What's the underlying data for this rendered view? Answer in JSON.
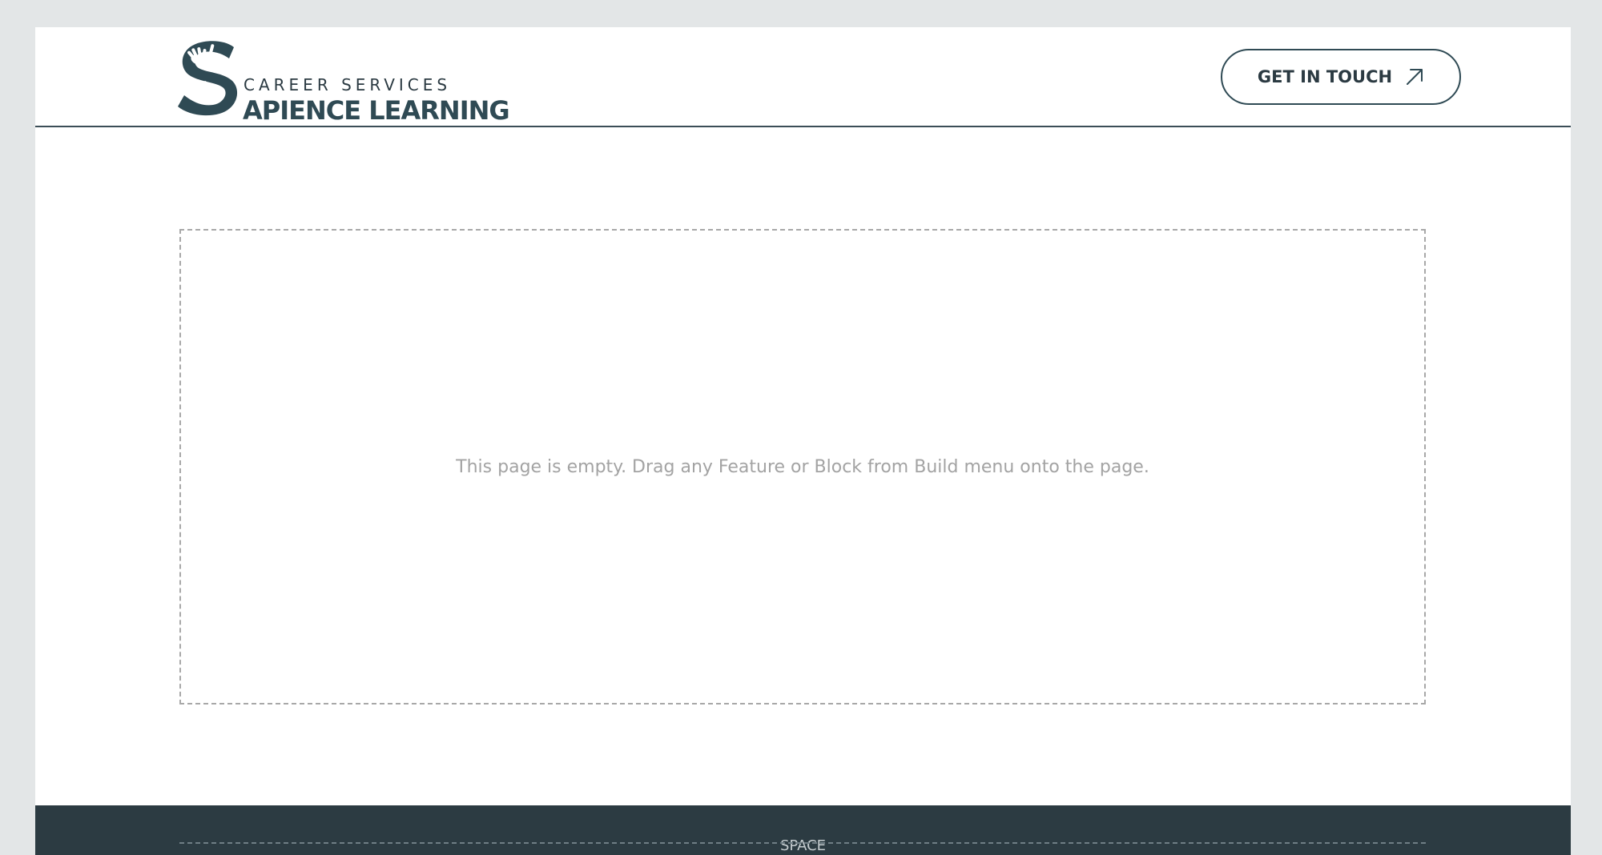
{
  "header": {
    "logo": {
      "subtitle": "CAREER SERVICES",
      "title": "APIENCE LEARNING",
      "monogram": "S",
      "icon": "hands-s-monogram-icon"
    },
    "cta": {
      "label": "GET IN TOUCH",
      "icon": "arrow-up-right-icon"
    }
  },
  "main": {
    "empty_message": "This page is empty. Drag any Feature or Block from Build menu onto the page."
  },
  "footer": {
    "label": "SPACE"
  },
  "colors": {
    "brand": "#2f4a54",
    "footer_bg": "#2c3b42",
    "page_bg": "#e3e6e7",
    "placeholder_text": "#a3a3a3"
  }
}
